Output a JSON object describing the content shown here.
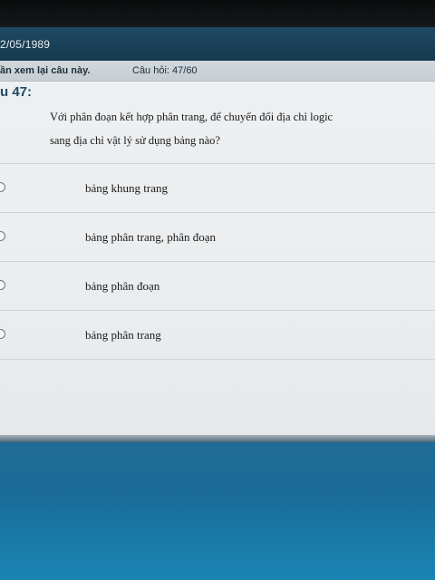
{
  "window": {
    "date_text": "2/05/1989"
  },
  "info_bar": {
    "review_text": "ần xem lại câu này.",
    "question_counter": "Câu hỏi: 47/60"
  },
  "question": {
    "number_label": "u 47:",
    "text_line1": "Với phân đoạn kết hợp phân trang, để chuyển đổi địa chỉ logic",
    "text_line2": "sang địa chỉ vật lý  sử dụng bảng nào?"
  },
  "options": [
    {
      "label": "bảng khung trang"
    },
    {
      "label": "bảng phân trang, phân đoạn"
    },
    {
      "label": "bảng phân đoạn"
    },
    {
      "label": "bảng phân trang"
    }
  ]
}
